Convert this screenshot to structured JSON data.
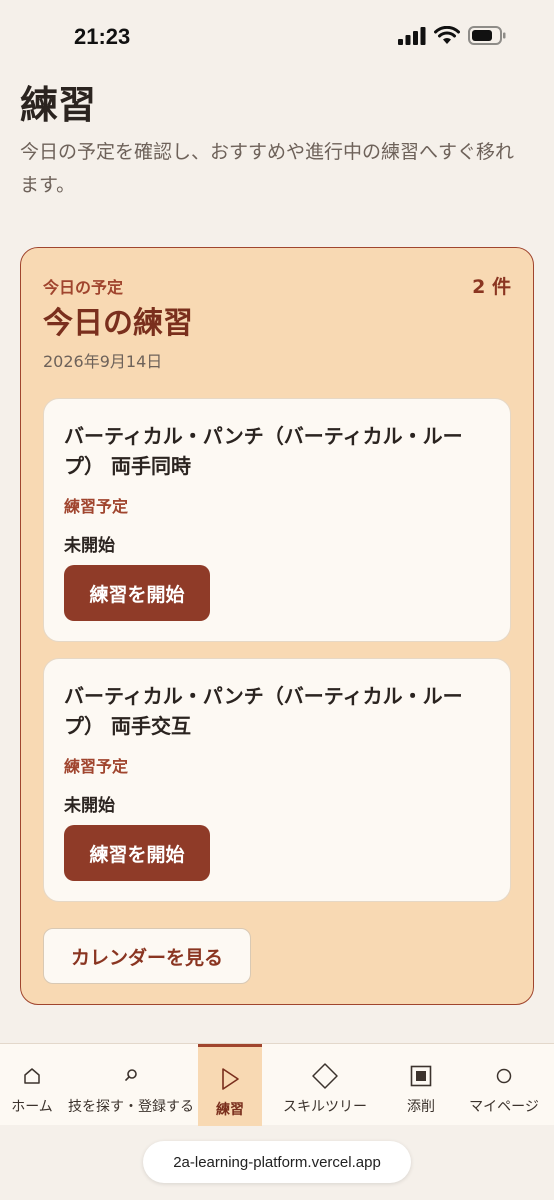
{
  "status_bar": {
    "time": "21:23",
    "icons": [
      "signal-icon",
      "wifi-icon",
      "battery-icon"
    ]
  },
  "page": {
    "title": "練習",
    "description": "今日の予定を確認し、おすすめや進行中の練習へすぐ移れます。"
  },
  "today_card": {
    "eyebrow": "今日の予定",
    "title": "今日の練習",
    "count": "2 件",
    "date": "2026年9月14日",
    "items": [
      {
        "title": "バーティカル・パンチ（バーティカル・ループ） 両手同時",
        "label": "練習予定",
        "status": "未開始",
        "button": "練習を開始"
      },
      {
        "title": "バーティカル・パンチ（バーティカル・ループ） 両手交互",
        "label": "練習予定",
        "status": "未開始",
        "button": "練習を開始"
      }
    ],
    "calendar_button": "カレンダーを見る"
  },
  "tab_bar": {
    "tabs": [
      {
        "label": "ホーム",
        "icon": "home-icon"
      },
      {
        "label": "技を探す・登録する",
        "icon": "search-icon"
      },
      {
        "label": "練習",
        "icon": "play-icon",
        "active": true
      },
      {
        "label": "スキルツリー",
        "icon": "diamond-icon"
      },
      {
        "label": "添削",
        "icon": "square-icon"
      },
      {
        "label": "マイページ",
        "icon": "circle-icon"
      }
    ]
  },
  "browser": {
    "url": "2a-learning-platform.vercel.app"
  },
  "colors": {
    "accent": "#a0452e",
    "button": "#8f3b28",
    "card_background": "#f8d9b3",
    "page_background": "#f5f0ea"
  }
}
